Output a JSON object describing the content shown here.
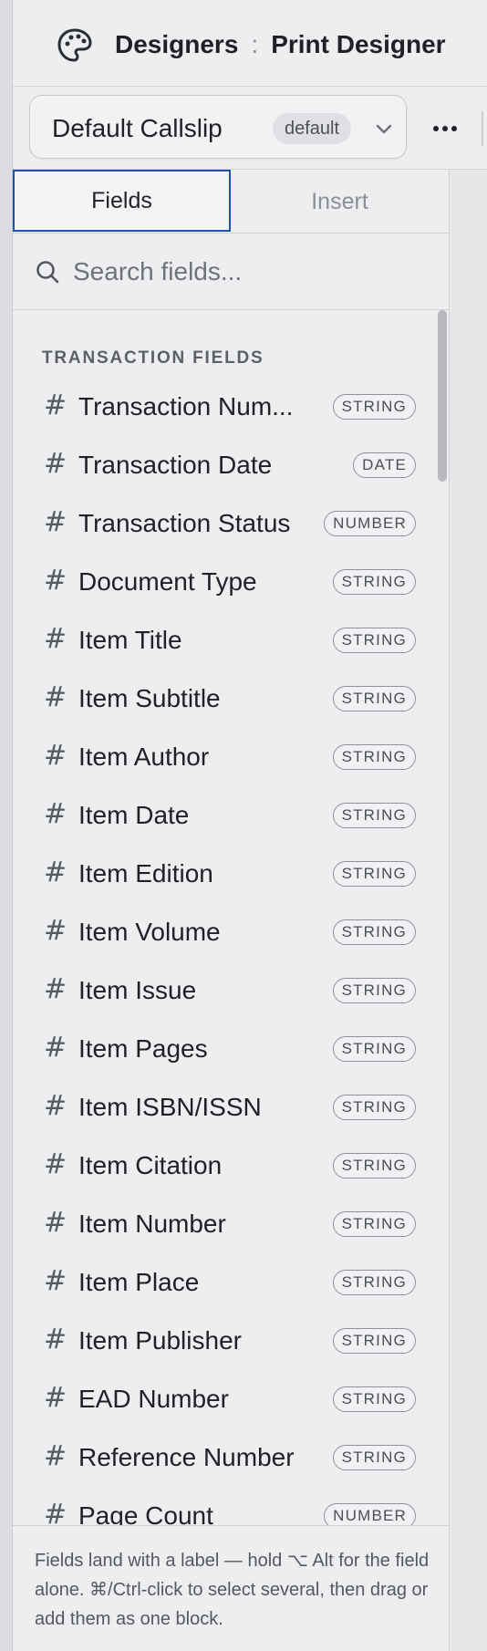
{
  "header": {
    "icon": "palette-icon",
    "breadcrumb_root": "Designers",
    "separator": ":",
    "breadcrumb_current": "Print Designer"
  },
  "template": {
    "name": "Default Callslip",
    "badge": "default",
    "dropdown_icon": "chevron-down-icon",
    "more_icon": "more-horizontal-icon"
  },
  "tabs": [
    {
      "label": "Fields",
      "active": true
    },
    {
      "label": "Insert",
      "active": false
    }
  ],
  "search": {
    "placeholder": "Search fields..."
  },
  "fields": {
    "section_title": "TRANSACTION FIELDS",
    "items": [
      {
        "label": "Transaction Num...",
        "type": "STRING"
      },
      {
        "label": "Transaction Date",
        "type": "DATE"
      },
      {
        "label": "Transaction Status",
        "type": "NUMBER"
      },
      {
        "label": "Document Type",
        "type": "STRING"
      },
      {
        "label": "Item Title",
        "type": "STRING"
      },
      {
        "label": "Item Subtitle",
        "type": "STRING"
      },
      {
        "label": "Item Author",
        "type": "STRING"
      },
      {
        "label": "Item Date",
        "type": "STRING"
      },
      {
        "label": "Item Edition",
        "type": "STRING"
      },
      {
        "label": "Item Volume",
        "type": "STRING"
      },
      {
        "label": "Item Issue",
        "type": "STRING"
      },
      {
        "label": "Item Pages",
        "type": "STRING"
      },
      {
        "label": "Item ISBN/ISSN",
        "type": "STRING"
      },
      {
        "label": "Item Citation",
        "type": "STRING"
      },
      {
        "label": "Item Number",
        "type": "STRING"
      },
      {
        "label": "Item Place",
        "type": "STRING"
      },
      {
        "label": "Item Publisher",
        "type": "STRING"
      },
      {
        "label": "EAD Number",
        "type": "STRING"
      },
      {
        "label": "Reference Number",
        "type": "STRING"
      },
      {
        "label": "Page Count",
        "type": "NUMBER"
      }
    ]
  },
  "footer": {
    "hint": "Fields land with a label — hold ⌥ Alt for the field alone. ⌘/Ctrl-click to select several, then drag or add them as one block."
  },
  "colors": {
    "accent": "#1f4fb0",
    "background": "#eceef0"
  }
}
